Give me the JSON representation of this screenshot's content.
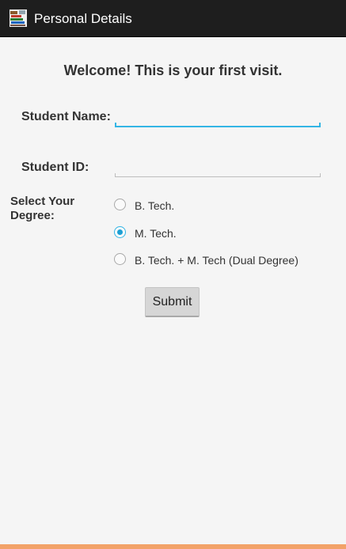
{
  "app": {
    "title": "Personal Details",
    "icon": "books-icon"
  },
  "form": {
    "welcome": "Welcome! This is your first visit.",
    "student_name_label": "Student Name:",
    "student_name_value": "",
    "student_id_label": "Student ID:",
    "student_id_value": "",
    "degree_label": "Select Your Degree:",
    "degree_options": [
      {
        "label": "B. Tech.",
        "checked": false
      },
      {
        "label": "M. Tech.",
        "checked": true
      },
      {
        "label": "B. Tech. + M. Tech (Dual Degree)",
        "checked": false
      }
    ],
    "submit_label": "Submit"
  },
  "colors": {
    "accent": "#33b5e5",
    "action_bar": "#1e1e1e",
    "background": "#f5f5f5",
    "bottom_strip": "#f2a268"
  }
}
